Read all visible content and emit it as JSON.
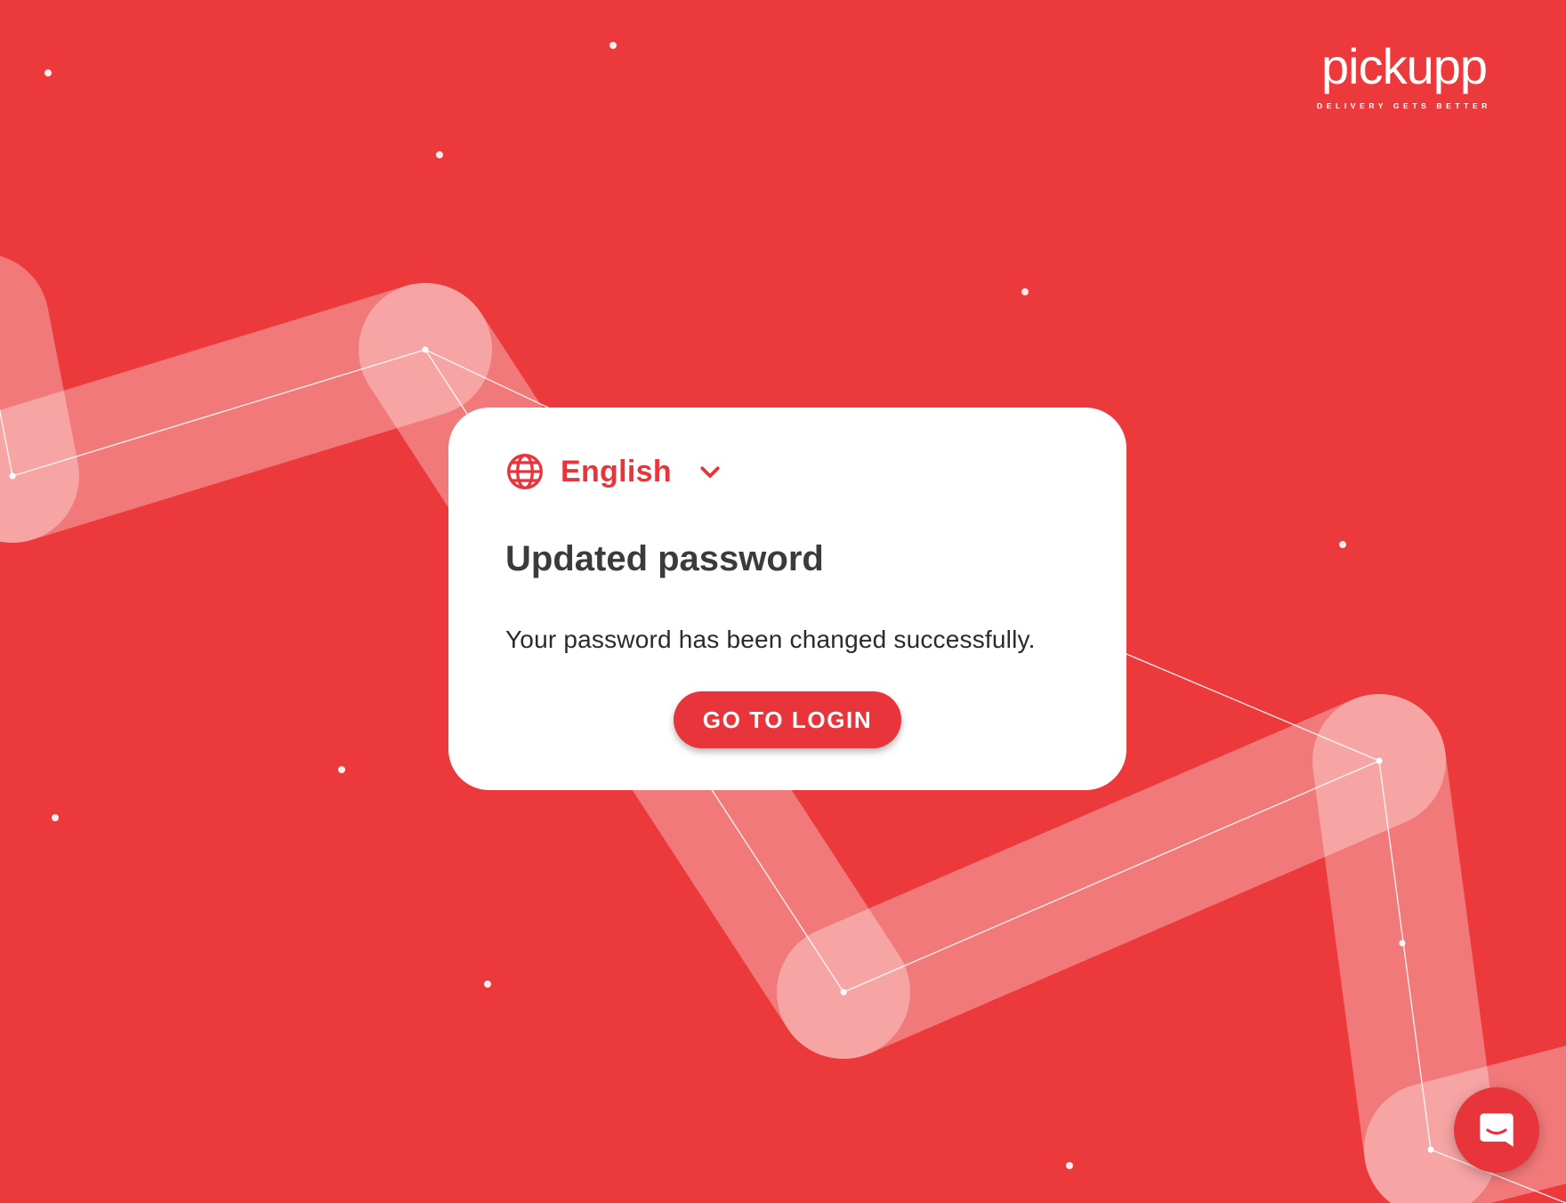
{
  "brand": {
    "name": "pickupp",
    "tagline": "DELIVERY GETS BETTER",
    "background_color": "#ec3a3c",
    "accent_color": "#e8353b"
  },
  "language_selector": {
    "icon": "globe-icon",
    "label": "English",
    "chevron": "chevron-down-icon"
  },
  "card": {
    "title": "Updated password",
    "message": "Your password has been changed successfully.",
    "button_label": "GO TO LOGIN"
  },
  "chat_widget": {
    "icon": "chat-icon"
  }
}
